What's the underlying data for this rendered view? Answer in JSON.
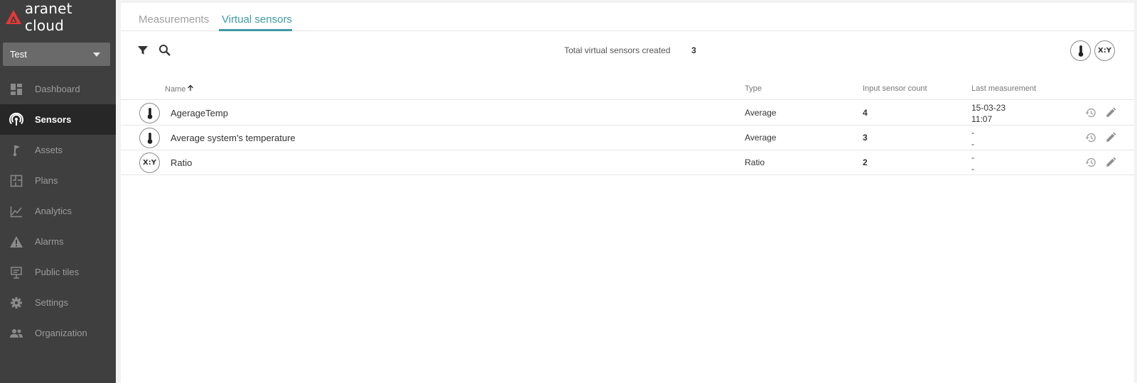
{
  "app": {
    "brand": "aranet cloud",
    "workspace": "Test"
  },
  "colors": {
    "sidebar_bg": "#3f3f3f",
    "sidebar_active_bg": "#272727",
    "accent": "#3e9aa5",
    "logo_red": "#e53935"
  },
  "sidebar": {
    "items": [
      {
        "label": "Dashboard",
        "icon": "dashboard-icon"
      },
      {
        "label": "Sensors",
        "icon": "sensors-icon",
        "active": true
      },
      {
        "label": "Assets",
        "icon": "assets-icon"
      },
      {
        "label": "Plans",
        "icon": "plans-icon"
      },
      {
        "label": "Analytics",
        "icon": "analytics-icon"
      },
      {
        "label": "Alarms",
        "icon": "alarms-icon"
      },
      {
        "label": "Public tiles",
        "icon": "public-tiles-icon"
      },
      {
        "label": "Settings",
        "icon": "settings-icon"
      },
      {
        "label": "Organization",
        "icon": "organization-icon"
      }
    ]
  },
  "tabs": [
    {
      "label": "Measurements",
      "active": false
    },
    {
      "label": "Virtual sensors",
      "active": true
    }
  ],
  "toolbar": {
    "total_label": "Total virtual sensors created",
    "total_count": "3",
    "ratio_button_label": "X:Y"
  },
  "table": {
    "columns": {
      "name": "Name",
      "type": "Type",
      "input_count": "Input sensor count",
      "last_measurement": "Last measurement"
    },
    "sort": {
      "column": "name",
      "direction": "ascending"
    },
    "rows": [
      {
        "icon": "thermometer-icon",
        "icon_text": "",
        "name": "AgerageTemp",
        "type": "Average",
        "input_count": "4",
        "last_line1": "15-03-23",
        "last_line2": "11:07"
      },
      {
        "icon": "thermometer-icon",
        "icon_text": "",
        "name": "Average system's temperature",
        "type": "Average",
        "input_count": "3",
        "last_line1": "-",
        "last_line2": "-"
      },
      {
        "icon": "ratio-icon",
        "icon_text": "X:Y",
        "name": "Ratio",
        "type": "Ratio",
        "input_count": "2",
        "last_line1": "-",
        "last_line2": "-"
      }
    ]
  }
}
